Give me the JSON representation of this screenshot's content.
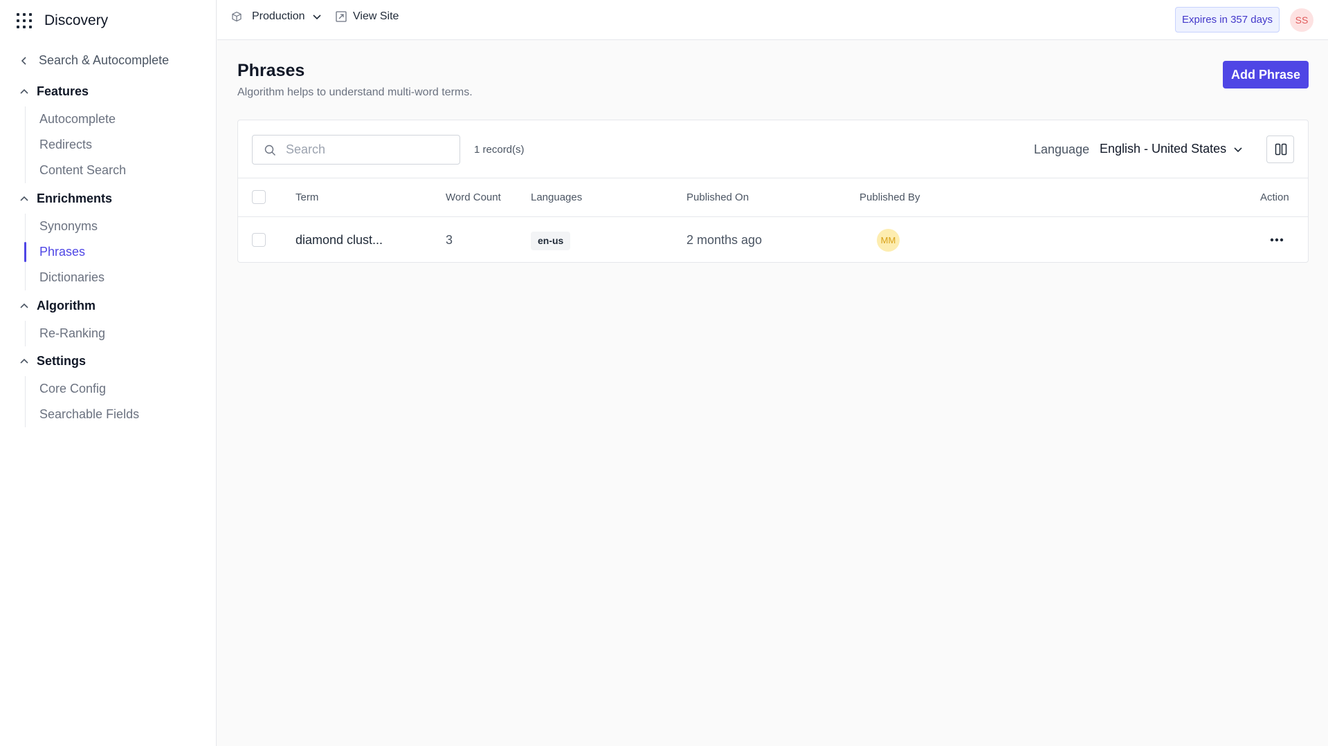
{
  "brand": {
    "name": "Discovery"
  },
  "sidebar": {
    "back_label": "Search & Autocomplete",
    "sections": [
      {
        "label": "Features",
        "items": [
          "Autocomplete",
          "Redirects",
          "Content Search"
        ]
      },
      {
        "label": "Enrichments",
        "items": [
          "Synonyms",
          "Phrases",
          "Dictionaries"
        ]
      },
      {
        "label": "Algorithm",
        "items": [
          "Re-Ranking"
        ]
      },
      {
        "label": "Settings",
        "items": [
          "Core Config",
          "Searchable Fields"
        ]
      }
    ],
    "active_item": "Phrases"
  },
  "topbar": {
    "environment": "Production",
    "view_site": "View Site",
    "expires": "Expires in 357 days",
    "user_initials": "SS"
  },
  "page": {
    "title": "Phrases",
    "subtitle": "Algorithm helps to understand multi-word terms.",
    "add_button": "Add Phrase"
  },
  "toolbar": {
    "search_placeholder": "Search",
    "records": "1 record(s)",
    "language_label": "Language",
    "language_value": "English - United States"
  },
  "table": {
    "headers": {
      "term": "Term",
      "word_count": "Word Count",
      "languages": "Languages",
      "published_on": "Published On",
      "published_by": "Published By",
      "action": "Action"
    },
    "rows": [
      {
        "term": "diamond clust...",
        "word_count": "3",
        "language": "en-us",
        "published_on": "2 months ago",
        "published_by": "MM"
      }
    ]
  },
  "colors": {
    "accent": "#4f46e5"
  }
}
